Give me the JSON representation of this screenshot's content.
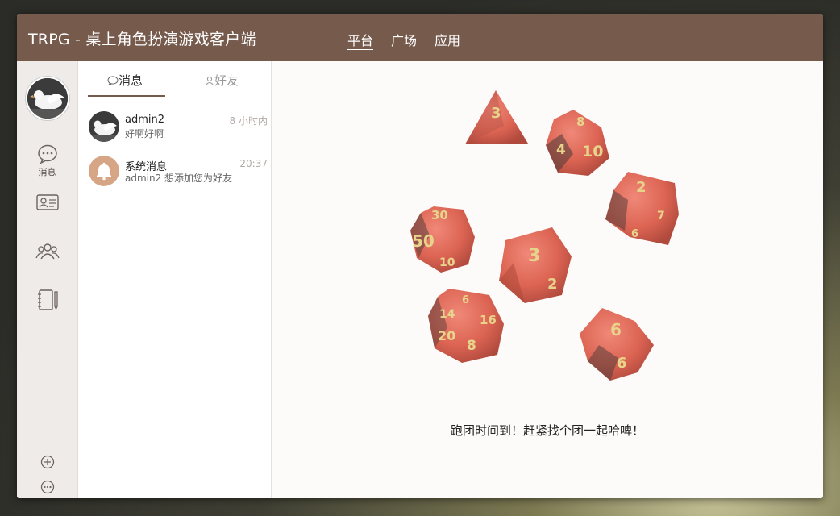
{
  "window": {
    "title": "TRPG - 桌上角色扮演游戏客户端",
    "nav": [
      "平台",
      "广场",
      "应用"
    ]
  },
  "sidebar": {
    "avatar": "dove-avatar",
    "items": [
      {
        "label": "消息",
        "icon": "chat-bubble-icon"
      },
      {
        "label": "",
        "icon": "contact-card-icon"
      },
      {
        "label": "",
        "icon": "group-icon"
      },
      {
        "label": "",
        "icon": "notebook-icon"
      }
    ],
    "bottom": [
      {
        "icon": "add-circle-icon"
      },
      {
        "icon": "more-circle-icon"
      }
    ]
  },
  "list": {
    "tabs": [
      {
        "label": "消息",
        "icon": "chat-small-icon"
      },
      {
        "label": "好友",
        "icon": "user-small-icon"
      }
    ],
    "conversations": [
      {
        "name": "admin2",
        "preview": "好啊好啊",
        "time": "8 小时内",
        "avatar": "dove"
      },
      {
        "name": "系统消息",
        "preview": "admin2 想添加您为好友",
        "time": "20:37",
        "avatar": "bell"
      }
    ]
  },
  "main": {
    "slogan": "跑团时间到！赶紧找个团一起哈啤！",
    "dice_numbers": [
      "3",
      "8",
      "4",
      "10",
      "2",
      "7",
      "6",
      "30",
      "50",
      "10",
      "3",
      "2",
      "14",
      "6",
      "16",
      "20",
      "8",
      "6",
      "6"
    ]
  },
  "colors": {
    "titlebar": "#765a4c",
    "dice": "#e06a5a",
    "dice_numbers": "#e8d38a"
  }
}
